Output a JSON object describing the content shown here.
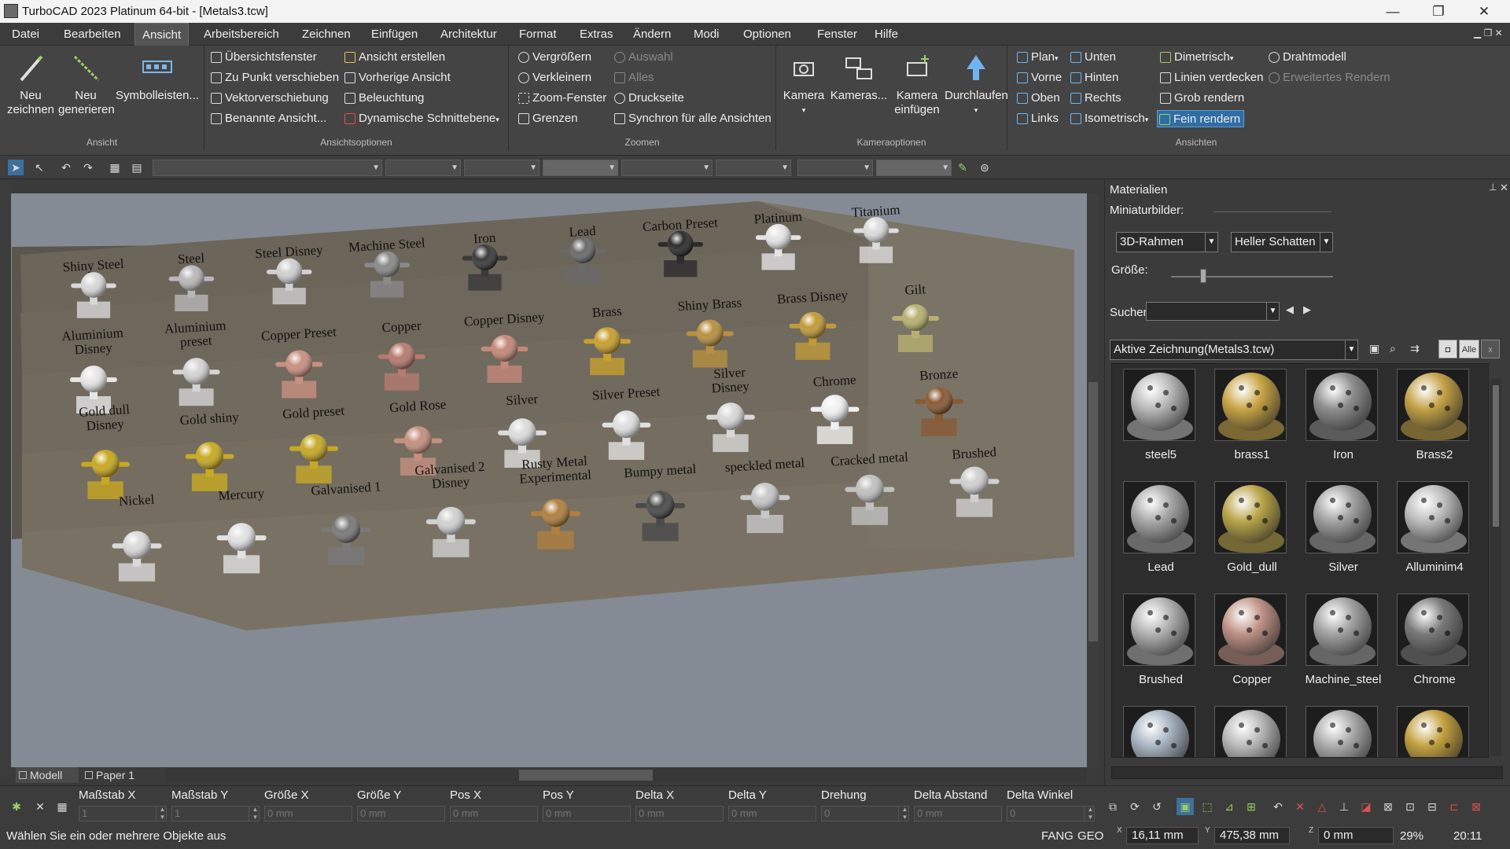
{
  "window": {
    "title": "TurboCAD 2023 Platinum 64-bit - [Metals3.tcw]",
    "minimize": "—",
    "restore": "❐",
    "close": "✕"
  },
  "menu": [
    "Datei",
    "Bearbeiten",
    "Ansicht",
    "Arbeitsbereich",
    "Zeichnen",
    "Einfügen",
    "Architektur",
    "Format",
    "Extras",
    "Ändern",
    "Modi",
    "Optionen",
    "Fenster",
    "Hilfe"
  ],
  "menu_active": "Ansicht",
  "ribbon": {
    "ansicht": {
      "label": "Ansicht",
      "neu_zeichnen": "Neu\nzeichnen",
      "neu_generieren": "Neu\ngenerieren",
      "symbolleisten": "Symbolleisten..."
    },
    "ansichtsoptionen": {
      "label": "Ansichtsoptionen",
      "col1": [
        "Übersichtsfenster",
        "Zu Punkt verschieben",
        "Vektorverschiebung",
        "Benannte Ansicht..."
      ],
      "col2": [
        "Ansicht erstellen",
        "Vorherige Ansicht",
        "Beleuchtung",
        "Dynamische Schnittebene"
      ]
    },
    "zoomen": {
      "label": "Zoomen",
      "col1": [
        "Vergrößern",
        "Verkleinern",
        "Zoom-Fenster",
        "Grenzen"
      ],
      "col2": [
        "Auswahl",
        "Alles",
        "Druckseite",
        "Synchron für alle Ansichten"
      ]
    },
    "kameraoptionen": {
      "label": "Kameraoptionen",
      "kamera": "Kamera",
      "kameras": "Kameras...",
      "kamera_einfuegen": "Kamera\neinfügen",
      "durchlaufen": "Durchlaufen"
    },
    "ansichten": {
      "label": "Ansichten",
      "col1": [
        "Plan",
        "Vorne",
        "Oben",
        "Links"
      ],
      "col2": [
        "Unten",
        "Hinten",
        "Rechts",
        "Isometrisch"
      ],
      "col3": [
        "Dimetrisch",
        "Linien verdecken",
        "Grob rendern",
        "Fein rendern"
      ],
      "col4": [
        "Drahtmodell",
        "Erweitertes Rendern"
      ]
    }
  },
  "tabs": {
    "modell": "Modell",
    "paper": "Paper 1"
  },
  "scene": {
    "rows": [
      {
        "labels": [
          "Shiny Steel",
          "Steel",
          "Steel Disney",
          "Machine Steel",
          "Iron",
          "Lead",
          "Carbon Preset",
          "Platinum",
          "Titanium"
        ],
        "colors": [
          "#d8d8d8",
          "#b8b8b8",
          "#d0d0d0",
          "#8a8a8a",
          "#3a3a3a",
          "#6a6a6a",
          "#2c2c2c",
          "#e4e4e4",
          "#dcdcdc"
        ]
      },
      {
        "labels": [
          "Aluminium\nDisney",
          "Aluminium\npreset",
          "Copper Preset",
          "Copper",
          "Copper Disney",
          "Brass",
          "Shiny Brass",
          "Brass Disney",
          "Gilt"
        ],
        "colors": [
          "#e6e6e6",
          "#d4d4d4",
          "#c89080",
          "#b77a6e",
          "#c48878",
          "#c8a030",
          "#b89040",
          "#c09a3a",
          "#b8b070"
        ]
      },
      {
        "labels": [
          "Gold dull\nDisney",
          "Gold shiny",
          "Gold preset",
          "Gold Rose",
          "Silver",
          "Silver Preset",
          "Silver\nDisney",
          "Chrome",
          "Bronze"
        ],
        "colors": [
          "#c8a820",
          "#c8aa22",
          "#c6a828",
          "#c49080",
          "#dcdcdc",
          "#e0e0e0",
          "#d8d8d8",
          "#f0f0f0",
          "#8a5a34"
        ]
      },
      {
        "labels": [
          "Nickel",
          "Mercury",
          "Galvanised 1",
          "Galvanised 2\nDisney",
          "Rusty Metal\nExperimental",
          "Bumpy metal",
          "speckled metal",
          "Cracked metal",
          "Brushed"
        ],
        "colors": [
          "#dadada",
          "#e2e2e2",
          "#7a7a7a",
          "#d0d0d0",
          "#b08040",
          "#4a4a4a",
          "#c8c8c8",
          "#c0c0c0",
          "#d0d0d0"
        ]
      }
    ]
  },
  "panel": {
    "title": "Materialien",
    "miniaturbilder": "Miniaturbilder:",
    "rahmen": "3D-Rahmen",
    "schatten": "Heller Schatten",
    "groesse": "Größe:",
    "size_fraction": 0.2,
    "suchen": "Suchen:",
    "suchen_value": "",
    "drawing": "Aktive Zeichnung(Metals3.tcw)",
    "all_label": "Alle",
    "materials": [
      {
        "name": "steel5",
        "color": "#b9b9b9"
      },
      {
        "name": "brass1",
        "color": "#c9a547"
      },
      {
        "name": "Iron",
        "color": "#8e8e8e"
      },
      {
        "name": "Brass2",
        "color": "#c3a147"
      },
      {
        "name": "Lead",
        "color": "#a8a8a8"
      },
      {
        "name": "Gold_dull",
        "color": "#b9a54a"
      },
      {
        "name": "Silver",
        "color": "#a2a2a2"
      },
      {
        "name": "Alluminim4",
        "color": "#bdbdbd"
      },
      {
        "name": "Brushed",
        "color": "#b3b3b3"
      },
      {
        "name": "Copper",
        "color": "#c09386"
      },
      {
        "name": "Machine_steel",
        "color": "#a3a3a3"
      },
      {
        "name": "Chrome",
        "color": "#7a7a7a"
      },
      {
        "name": "",
        "color": "#a8b4c2"
      },
      {
        "name": "",
        "color": "#b8b8b8"
      },
      {
        "name": "",
        "color": "#acacac"
      },
      {
        "name": "",
        "color": "#c2a040"
      }
    ]
  },
  "coords": [
    {
      "label": "Maßstab X",
      "value": "1",
      "spin": true
    },
    {
      "label": "Maßstab Y",
      "value": "1",
      "spin": true
    },
    {
      "label": "Größe X",
      "value": "0 mm",
      "spin": false
    },
    {
      "label": "Größe Y",
      "value": "0 mm",
      "spin": false
    },
    {
      "label": "Pos X",
      "value": "0 mm",
      "spin": false
    },
    {
      "label": "Pos Y",
      "value": "0 mm",
      "spin": false
    },
    {
      "label": "Delta X",
      "value": "0 mm",
      "spin": false
    },
    {
      "label": "Delta Y",
      "value": "0 mm",
      "spin": false
    },
    {
      "label": "Drehung",
      "value": "0",
      "spin": true
    },
    {
      "label": "Delta Abstand",
      "value": "0 mm",
      "spin": false
    },
    {
      "label": "Delta Winkel",
      "value": "0",
      "spin": true
    }
  ],
  "status": {
    "message": "Wählen Sie ein oder mehrere Objekte aus",
    "fang": "FANG",
    "geo": "GEO",
    "x_label": "X",
    "x": "16,11 mm",
    "y_label": "Y",
    "y": "475,38 mm",
    "z_label": "Z",
    "z": "0 mm",
    "zoom": "29%",
    "time": "20:11"
  },
  "colors": {
    "highlight": "#2f6da3",
    "background": "#3c3c3c"
  }
}
